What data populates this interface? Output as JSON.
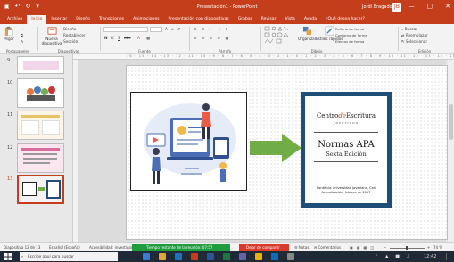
{
  "window": {
    "title": "Presentación1 - PowerPoint",
    "user": "Jordi Bragado",
    "avatar_initials": "JB",
    "quick_access": [
      "save-icon",
      "undo-icon",
      "redo-icon",
      "customize-icon"
    ],
    "window_buttons": {
      "minimize": "—",
      "maximize": "▢",
      "close": "✕"
    }
  },
  "tabs": [
    "Archivo",
    "Inicio",
    "Insertar",
    "Diseño",
    "Transiciones",
    "Animaciones",
    "Presentación con diapositivas",
    "Grabar",
    "Revisar",
    "Vista",
    "Ayuda",
    "¿Qué desea hacer?"
  ],
  "active_tab": "Inicio",
  "ribbon": {
    "clipboard": {
      "label": "Portapapeles",
      "paste": "Pegar",
      "cut": "Cortar",
      "copy": "Copiar"
    },
    "slides": {
      "label": "Diapositivas",
      "new_slide": "Nueva diapositiva",
      "layout": "Diseño",
      "reset": "Restablecer",
      "section": "Sección"
    },
    "font": {
      "label": "Fuente",
      "bold": "N",
      "italic": "K",
      "underline": "S",
      "strike": "abc",
      "size_up": "A",
      "size_down": "A"
    },
    "paragraph": {
      "label": "Párrafo"
    },
    "drawing": {
      "label": "Dibujo",
      "arrange": "Organizar",
      "quick_styles": "Estilos rápidos",
      "fill": "Relleno de forma",
      "outline": "Contorno de forma",
      "effects": "Efectos de forma"
    },
    "editing": {
      "label": "Edición",
      "find": "Buscar",
      "replace": "Reemplazar",
      "select": "Seleccionar"
    }
  },
  "ruler_text": "16 · 15 · 14 · 13 · 12 · 11 · 10 · 9 · 8 · 7 · 6 · 5 · 4 · 3 · 2 · 1 · 0 · 1 · 2 · 3 · 4 · 5 · 6 · 7 · 8 · 9 · 10 · 11 · 12 · 13 · 14 · 15 · 16",
  "thumbnails": [
    {
      "number": "9"
    },
    {
      "number": "10"
    },
    {
      "number": "11"
    },
    {
      "number": "12",
      "selected": true
    },
    {
      "number": "13"
    }
  ],
  "slide": {
    "title_card": {
      "logo_main": "Centro",
      "logo_de": "de",
      "logo_end": "Escritura",
      "logo_sub": "Javeriano",
      "heading": "Normas APA",
      "subheading": "Sexta Edición",
      "footer_line1": "Pontificia Universidad Javeriana, Cali",
      "footer_line2": "Actualización, febrero de 2017"
    },
    "arrow_color": "#70ad47",
    "card_border_color": "#1f4e79"
  },
  "status": {
    "slide_info": "Diapositiva 12 de 13",
    "language": "Español (España)",
    "accessibility": "Accesibilidad: investigar",
    "recording": "Tiempo restante de la reunión: 07:57",
    "stop_share": "Dejar de compartir",
    "notes": "Notas",
    "comments": "Comentarios",
    "zoom": "74 %"
  },
  "taskbar": {
    "search_placeholder": "Escribe aquí para buscar",
    "time": "12:42"
  },
  "colors": {
    "accent": "#c43e1c",
    "status_green": "#1f9c3e",
    "status_red": "#d83b2b"
  }
}
